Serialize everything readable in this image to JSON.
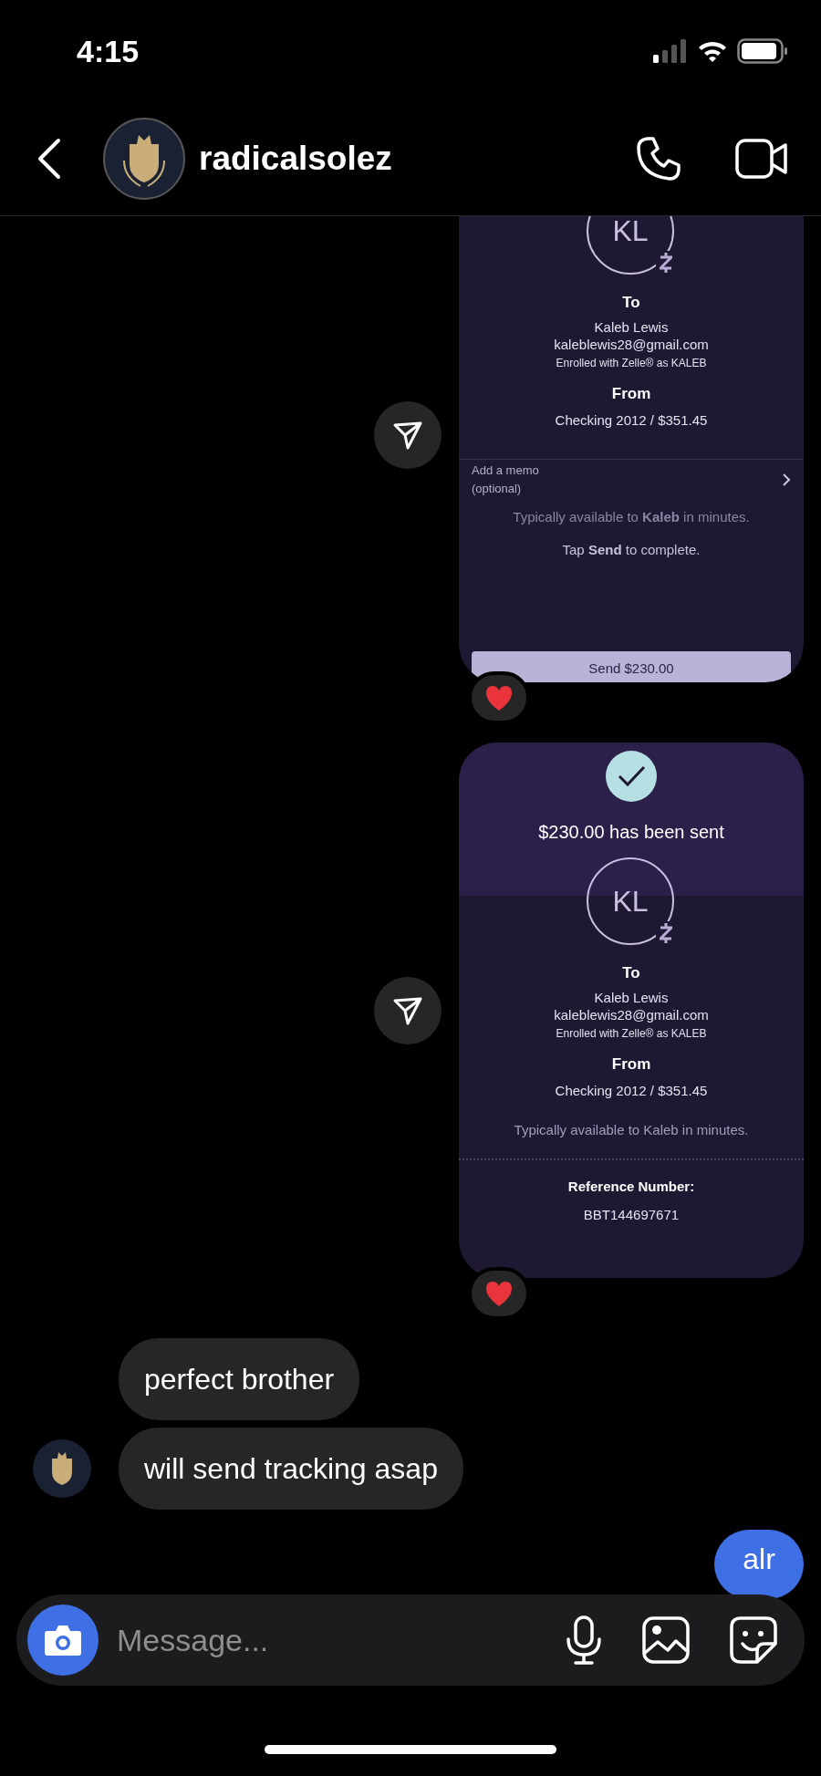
{
  "status_bar": {
    "time": "4:15"
  },
  "header": {
    "username": "radicalsolez"
  },
  "messages": [
    {
      "kind": "zelle_review",
      "hearted": true,
      "initials": "KL",
      "to_label": "To",
      "recipient": "Kaleb Lewis",
      "email": "kaleblewis28@gmail.com",
      "enrolled": "Enrolled with Zelle® as KALEB",
      "from_label": "From",
      "account": "Checking 2012 / $351.45",
      "memo_label": "Add a memo",
      "memo_hint": "(optional)",
      "availability": "Typically available to **Kaleb** in minutes.",
      "instruction": "Tap **Send** to complete.",
      "button": "Send $230.00"
    },
    {
      "kind": "zelle_sent",
      "hearted": true,
      "title": "$230.00 has been sent",
      "initials": "KL",
      "to_label": "To",
      "recipient": "Kaleb Lewis",
      "email": "kaleblewis28@gmail.com",
      "enrolled": "Enrolled with Zelle® as KALEB",
      "from_label": "From",
      "account": "Checking 2012 / $351.45",
      "availability": "Typically available to Kaleb in minutes.",
      "reference_label": "Reference Number:",
      "reference_number": "BBT144697671"
    },
    {
      "kind": "incoming_text",
      "show_avatar": false,
      "text": "perfect brother"
    },
    {
      "kind": "incoming_text",
      "show_avatar": true,
      "text": "will send tracking asap"
    },
    {
      "kind": "outgoing_text",
      "text": "alr"
    }
  ],
  "composer": {
    "placeholder": "Message..."
  }
}
